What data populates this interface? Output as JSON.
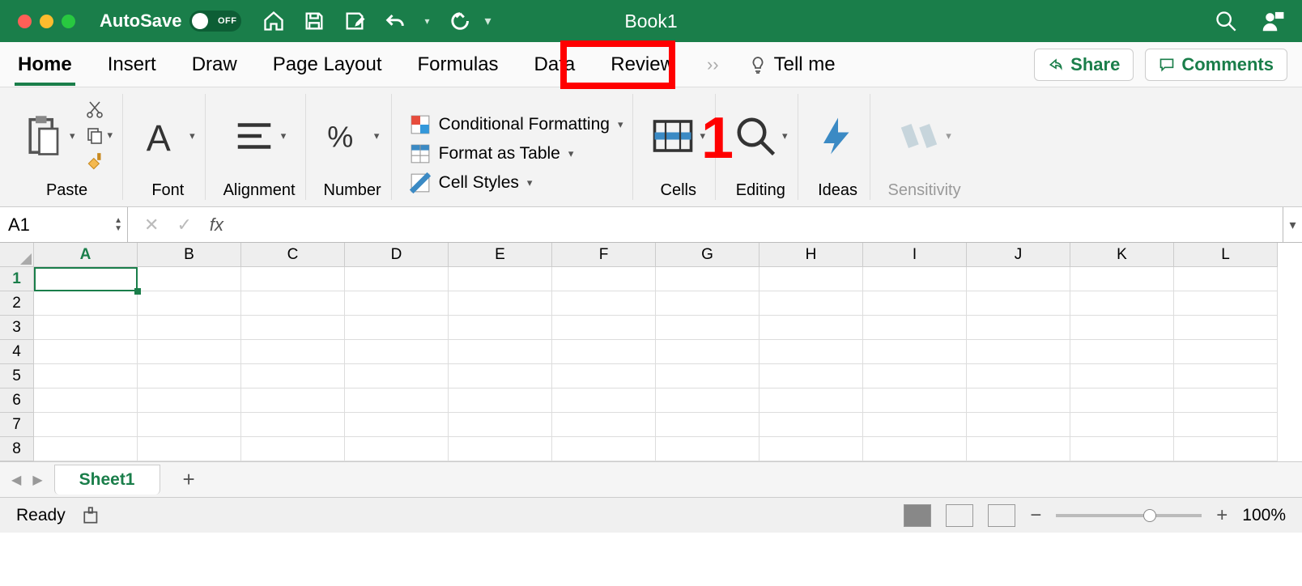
{
  "titlebar": {
    "autosave_label": "AutoSave",
    "autosave_state": "OFF",
    "document_title": "Book1"
  },
  "tabs": {
    "items": [
      "Home",
      "Insert",
      "Draw",
      "Page Layout",
      "Formulas",
      "Data",
      "Review"
    ],
    "active_index": 0,
    "highlighted_index": 5,
    "tell_me": "Tell me",
    "share": "Share",
    "comments": "Comments"
  },
  "ribbon": {
    "paste": "Paste",
    "font": "Font",
    "alignment": "Alignment",
    "number": "Number",
    "cond_format": "Conditional Formatting",
    "format_table": "Format as Table",
    "cell_styles": "Cell Styles",
    "cells": "Cells",
    "editing": "Editing",
    "ideas": "Ideas",
    "sensitivity": "Sensitivity"
  },
  "formulabar": {
    "namebox": "A1",
    "fx": "fx",
    "value": ""
  },
  "grid": {
    "columns": [
      "A",
      "B",
      "C",
      "D",
      "E",
      "F",
      "G",
      "H",
      "I",
      "J",
      "K",
      "L"
    ],
    "rows": [
      1,
      2,
      3,
      4,
      5,
      6,
      7,
      8
    ],
    "selected": {
      "col": "A",
      "row": 1
    }
  },
  "sheets": {
    "active": "Sheet1"
  },
  "status": {
    "state": "Ready",
    "zoom": "100%"
  },
  "annotation": {
    "marker": "1"
  }
}
